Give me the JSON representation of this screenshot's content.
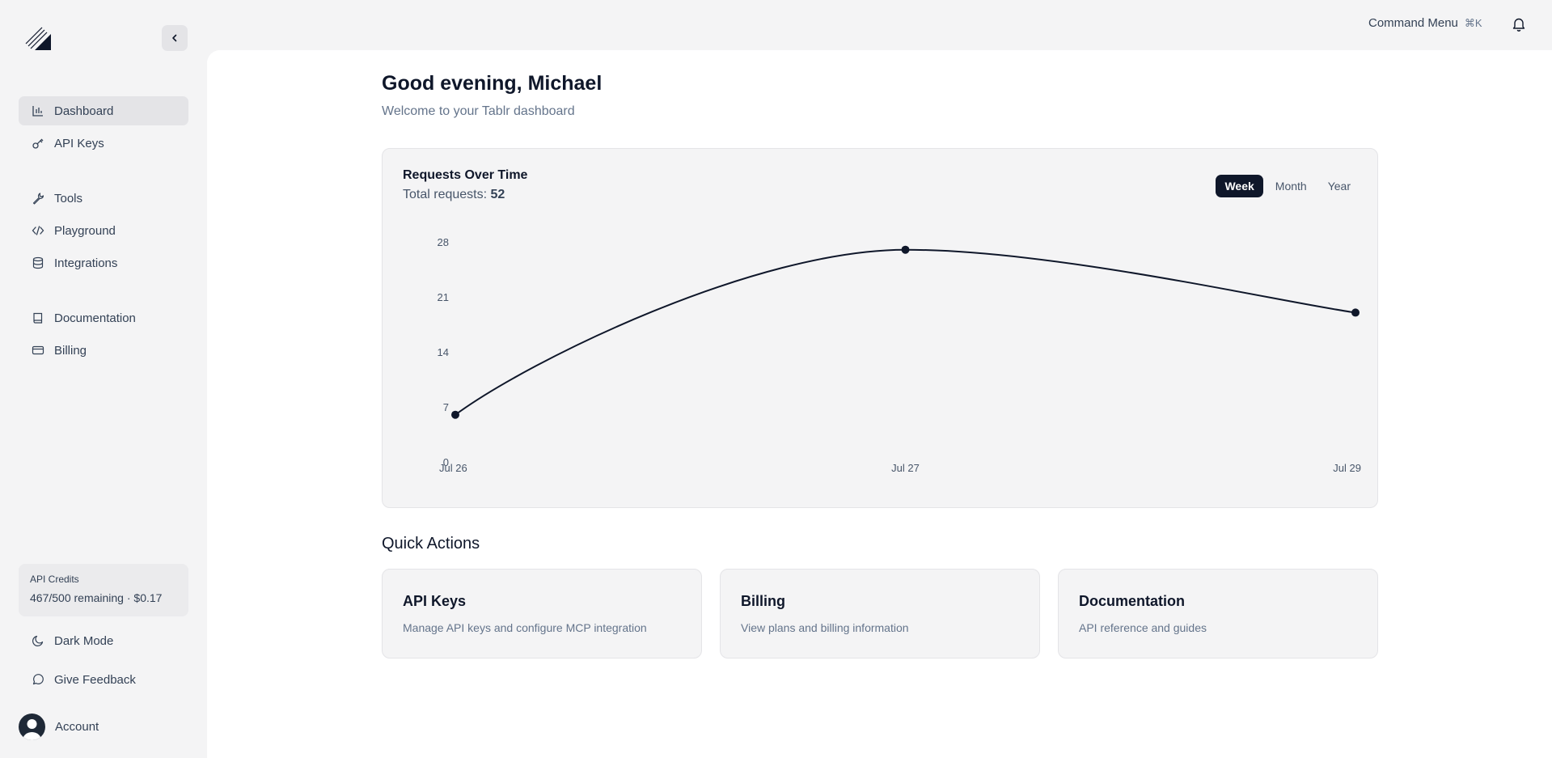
{
  "sidebar": {
    "nav_primary": [
      {
        "label": "Dashboard",
        "icon": "bar-chart-icon",
        "active": true
      },
      {
        "label": "API Keys",
        "icon": "key-icon"
      }
    ],
    "nav_tools": [
      {
        "label": "Tools",
        "icon": "wrench-icon"
      },
      {
        "label": "Playground",
        "icon": "code-icon"
      },
      {
        "label": "Integrations",
        "icon": "database-icon"
      }
    ],
    "nav_docs": [
      {
        "label": "Documentation",
        "icon": "book-icon"
      },
      {
        "label": "Billing",
        "icon": "credit-card-icon"
      }
    ],
    "credits": {
      "title": "API Credits",
      "value": "467/500 remaining · $0.17"
    },
    "dark_mode": "Dark Mode",
    "feedback": "Give Feedback",
    "account": "Account"
  },
  "topbar": {
    "command_menu": "Command Menu",
    "shortcut": "⌘K"
  },
  "main": {
    "greeting": "Good evening, Michael",
    "subtitle": "Welcome to your Tablr dashboard",
    "chart_card": {
      "title": "Requests Over Time",
      "total_label": "Total requests: ",
      "total_value": "52",
      "ranges": [
        {
          "label": "Week",
          "active": true
        },
        {
          "label": "Month"
        },
        {
          "label": "Year"
        }
      ]
    },
    "quick_actions": {
      "title": "Quick Actions",
      "items": [
        {
          "title": "API Keys",
          "desc": "Manage API keys and configure MCP integration"
        },
        {
          "title": "Billing",
          "desc": "View plans and billing information"
        },
        {
          "title": "Documentation",
          "desc": "API reference and guides"
        }
      ]
    }
  },
  "chart_data": {
    "type": "line",
    "x": [
      "Jul 26",
      "Jul 27",
      "Jul 29"
    ],
    "values": [
      6,
      27,
      19
    ],
    "yticks": [
      0,
      7,
      14,
      21,
      28
    ],
    "ylim": [
      0,
      28
    ],
    "title": "Requests Over Time",
    "grid": false,
    "line_color": "#0f172a"
  }
}
